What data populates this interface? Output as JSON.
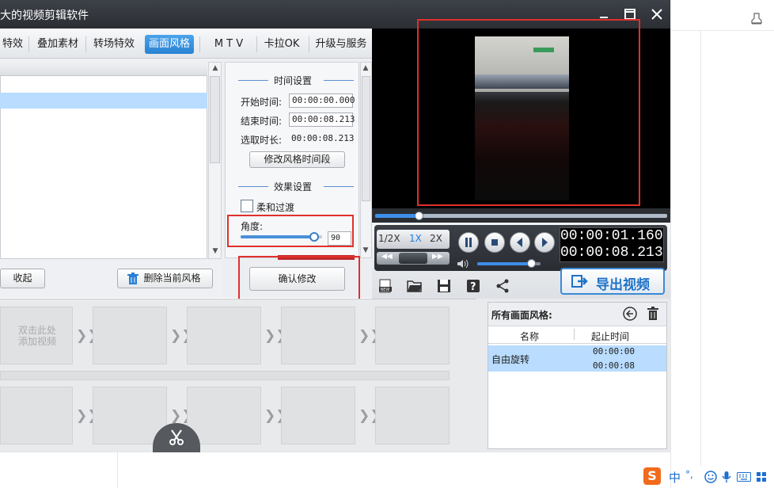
{
  "window": {
    "title": "大的视频剪辑软件",
    "min_icon": "minimize-icon",
    "max_icon": "maximize-icon",
    "close_icon": "close-icon"
  },
  "tabs": [
    {
      "label": "特效"
    },
    {
      "label": "叠加素材"
    },
    {
      "label": "转场特效"
    },
    {
      "label": "画面风格",
      "active": true
    },
    {
      "label": "M T V"
    },
    {
      "label": "卡拉OK"
    },
    {
      "label": "升级与服务"
    }
  ],
  "left_panel": {
    "collapse_label": "收起",
    "delete_label": "删除当前风格"
  },
  "time_settings": {
    "heading": "时间设置",
    "start_label": "开始时间:",
    "start_value": "00:00:00.000",
    "end_label": "结束时间:",
    "end_value": "00:00:08.213",
    "duration_label": "选取时长:",
    "duration_value": "00:00:08.213",
    "modify_label": "修改风格时间段"
  },
  "effect_settings": {
    "heading": "效果设置",
    "soft_label": "柔和过渡",
    "angle_label": "角度:",
    "angle_value": "90",
    "angle_level": 0.9,
    "confirm_label": "确认修改"
  },
  "player": {
    "speed_half": "1/2X",
    "speed_1x": "1X",
    "speed_2x": "2X",
    "current_time": "00:00:01.160",
    "total_time": "00:00:08.213",
    "playback_progress": 0.15,
    "volume_level": 0.85,
    "export_label": "导出视频"
  },
  "timeline": {
    "add_video_line1": "双击此处",
    "add_video_line2": "添加视频"
  },
  "styles_panel": {
    "title": "所有画面风格:",
    "col_name": "名称",
    "col_time": "起止时间",
    "rows": [
      {
        "name": "自由旋转",
        "start": "00:00:00",
        "end": "00:00:08"
      }
    ]
  },
  "tray": {
    "ime_label": "中",
    "ime_punct": "°,"
  },
  "colors": {
    "accent": "#2a83d3",
    "highlight": "#b9dcff",
    "annotation": "#e0302d",
    "time_text": "#ffffff"
  }
}
